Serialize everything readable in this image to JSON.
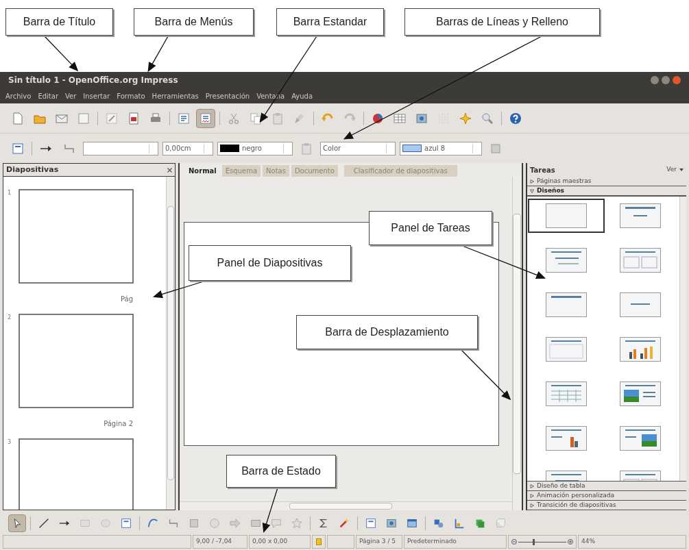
{
  "callouts": [
    {
      "label": "Barra de Título"
    },
    {
      "label": "Barra de Menús"
    },
    {
      "label": "Barra Estandar"
    },
    {
      "label": "Barras de Líneas y Relleno"
    },
    {
      "label": "Panel de Diapositivas"
    },
    {
      "label": "Panel de Tareas"
    },
    {
      "label": "Barra de Desplazamiento"
    },
    {
      "label": "Barra de Estado"
    }
  ],
  "window": {
    "title": "Sin título 1 - OpenOffice.org Impress"
  },
  "menu": [
    "Archivo",
    "Editar",
    "Ver",
    "Insertar",
    "Formato",
    "Herramientas",
    "Presentación",
    "Ventana",
    "Ayuda"
  ],
  "standard_toolbar": [
    {
      "kind": "new",
      "pressed": false
    },
    {
      "kind": "open",
      "pressed": false
    },
    {
      "kind": "email",
      "pressed": false
    },
    {
      "kind": "export",
      "pressed": false
    },
    {
      "kind": "sep"
    },
    {
      "kind": "edit",
      "pressed": false
    },
    {
      "kind": "pdf",
      "pressed": false
    },
    {
      "kind": "print",
      "pressed": false
    },
    {
      "kind": "sep"
    },
    {
      "kind": "spellcheck",
      "pressed": false
    },
    {
      "kind": "autospell",
      "pressed": true
    },
    {
      "kind": "sep"
    },
    {
      "kind": "cut",
      "pressed": false
    },
    {
      "kind": "copy",
      "pressed": false
    },
    {
      "kind": "paste",
      "pressed": false
    },
    {
      "kind": "brush",
      "pressed": false
    },
    {
      "kind": "sep"
    },
    {
      "kind": "undo",
      "pressed": false
    },
    {
      "kind": "redo",
      "pressed": false
    },
    {
      "kind": "sep"
    },
    {
      "kind": "chart",
      "pressed": false
    },
    {
      "kind": "table",
      "pressed": false
    },
    {
      "kind": "image",
      "pressed": false
    },
    {
      "kind": "grid",
      "pressed": false
    },
    {
      "kind": "navigator",
      "pressed": false
    },
    {
      "kind": "zoom",
      "pressed": false
    },
    {
      "kind": "sep"
    },
    {
      "kind": "help",
      "pressed": false
    }
  ],
  "line_fill_toolbar": {
    "line_width": "0,00cm",
    "line_color": "negro",
    "area_style": "Color",
    "fill_color": "azul 8"
  },
  "slides_panel": {
    "title": "Diapositivas",
    "slides": [
      {
        "number": "1",
        "caption": "Pág"
      },
      {
        "number": "2",
        "caption": "Página 2"
      },
      {
        "number": "3"
      }
    ]
  },
  "view_tabs": [
    {
      "label": "Normal",
      "selected": true
    },
    {
      "label": "Esquema",
      "selected": false
    },
    {
      "label": "Notas",
      "selected": false
    },
    {
      "label": "Documento",
      "selected": false
    },
    {
      "label": "Clasificador de diapositivas",
      "selected": false
    }
  ],
  "tasks_panel": {
    "title": "Tareas",
    "view_menu": "Ver",
    "sections_top": [
      {
        "label": "Páginas maestras",
        "expanded": false
      },
      {
        "label": "Diseños",
        "expanded": true
      }
    ],
    "layouts": [
      {
        "kind": "blank",
        "selected": true
      },
      {
        "kind": "title-subtitle",
        "selected": false
      },
      {
        "kind": "title-content",
        "selected": false
      },
      {
        "kind": "title-two-content",
        "selected": false
      },
      {
        "kind": "title-only",
        "selected": false
      },
      {
        "kind": "centered",
        "selected": false
      },
      {
        "kind": "title-empty",
        "selected": false
      },
      {
        "kind": "title-chart",
        "selected": false
      },
      {
        "kind": "title-table",
        "selected": false
      },
      {
        "kind": "picture-text",
        "selected": false
      },
      {
        "kind": "text-chart",
        "selected": false
      },
      {
        "kind": "text-picture",
        "selected": false
      },
      {
        "kind": "title-content",
        "selected": false
      },
      {
        "kind": "title-two-content",
        "selected": false
      }
    ],
    "sections_bottom": [
      {
        "label": "Diseño de tabla",
        "expanded": false
      },
      {
        "label": "Animación personalizada",
        "expanded": false
      },
      {
        "label": "Transición de diapositivas",
        "expanded": false
      }
    ]
  },
  "drawing_toolbar": [
    {
      "kind": "select",
      "pressed": true
    },
    {
      "kind": "sep"
    },
    {
      "kind": "line",
      "pressed": false
    },
    {
      "kind": "arrow",
      "pressed": false
    },
    {
      "kind": "rect",
      "pressed": false
    },
    {
      "kind": "ellipse",
      "pressed": false
    },
    {
      "kind": "fontwork",
      "pressed": false
    },
    {
      "kind": "sep"
    },
    {
      "kind": "curve",
      "pressed": false
    },
    {
      "kind": "connector",
      "pressed": false
    },
    {
      "kind": "basic",
      "pressed": false
    },
    {
      "kind": "symbol",
      "pressed": false
    },
    {
      "kind": "arrows",
      "pressed": false
    },
    {
      "kind": "flowchart",
      "pressed": false
    },
    {
      "kind": "callout",
      "pressed": false
    },
    {
      "kind": "star",
      "pressed": false
    },
    {
      "kind": "sep"
    },
    {
      "kind": "points",
      "pressed": false
    },
    {
      "kind": "glue",
      "pressed": false
    },
    {
      "kind": "sep"
    },
    {
      "kind": "fontwork",
      "pressed": false
    },
    {
      "kind": "image",
      "pressed": false
    },
    {
      "kind": "gallery",
      "pressed": false
    },
    {
      "kind": "sep"
    },
    {
      "kind": "rotate",
      "pressed": false
    },
    {
      "kind": "align",
      "pressed": false
    },
    {
      "kind": "arrange",
      "pressed": false
    },
    {
      "kind": "extrusion",
      "pressed": false
    }
  ],
  "status_bar": {
    "position": "9,00 / -7,04",
    "size": "0,00 x 0,00",
    "page": "Página 3 / 5",
    "master": "Predeterminado",
    "zoom_slider": {
      "level": 0.3
    },
    "zoom": "44%"
  }
}
